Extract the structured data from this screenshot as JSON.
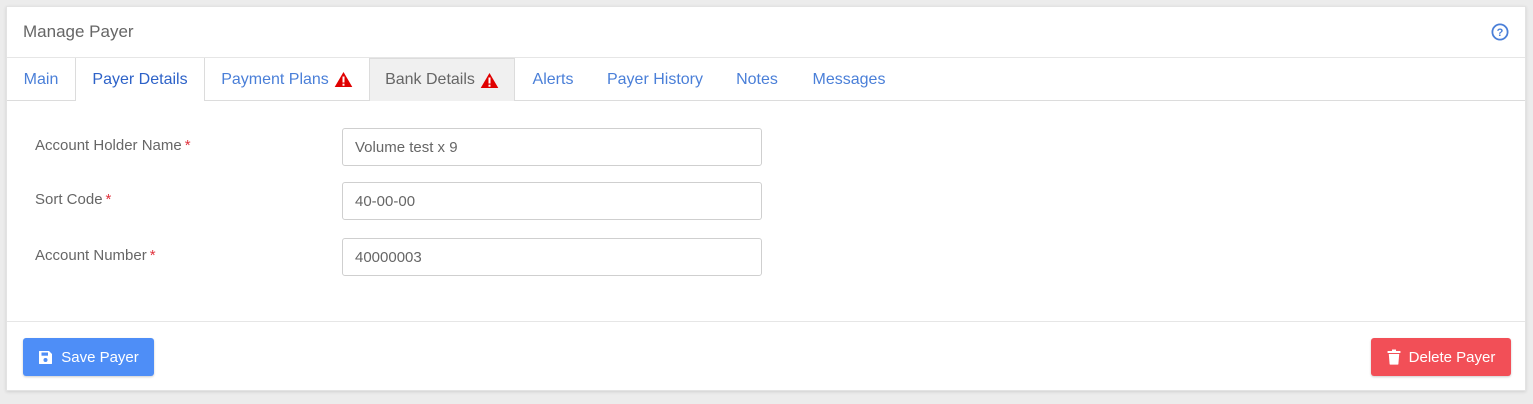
{
  "header": {
    "title": "Manage Payer",
    "help_icon": "question-circle-icon"
  },
  "tabs": [
    {
      "label": "Main",
      "warning": false
    },
    {
      "label": "Payer Details",
      "warning": false
    },
    {
      "label": "Payment Plans",
      "warning": true
    },
    {
      "label": "Bank Details",
      "warning": true,
      "active": true
    },
    {
      "label": "Alerts",
      "warning": false
    },
    {
      "label": "Payer History",
      "warning": false
    },
    {
      "label": "Notes",
      "warning": false
    },
    {
      "label": "Messages",
      "warning": false
    }
  ],
  "form": {
    "account_holder_name": {
      "label": "Account Holder Name",
      "required_mark": "*",
      "value": "Volume test x 9"
    },
    "sort_code": {
      "label": "Sort Code",
      "required_mark": "*",
      "value": "40-00-00"
    },
    "account_number": {
      "label": "Account Number",
      "required_mark": "*",
      "value": "40000003"
    }
  },
  "footer": {
    "save_label": "Save Payer",
    "delete_label": "Delete Payer"
  },
  "colors": {
    "link_blue": "#4a7fd8",
    "active_tab_text": "#666666",
    "warning_red": "#e00000",
    "save_button": "#4e8ef7",
    "delete_button": "#f24f57",
    "required_red": "#e0323d"
  }
}
